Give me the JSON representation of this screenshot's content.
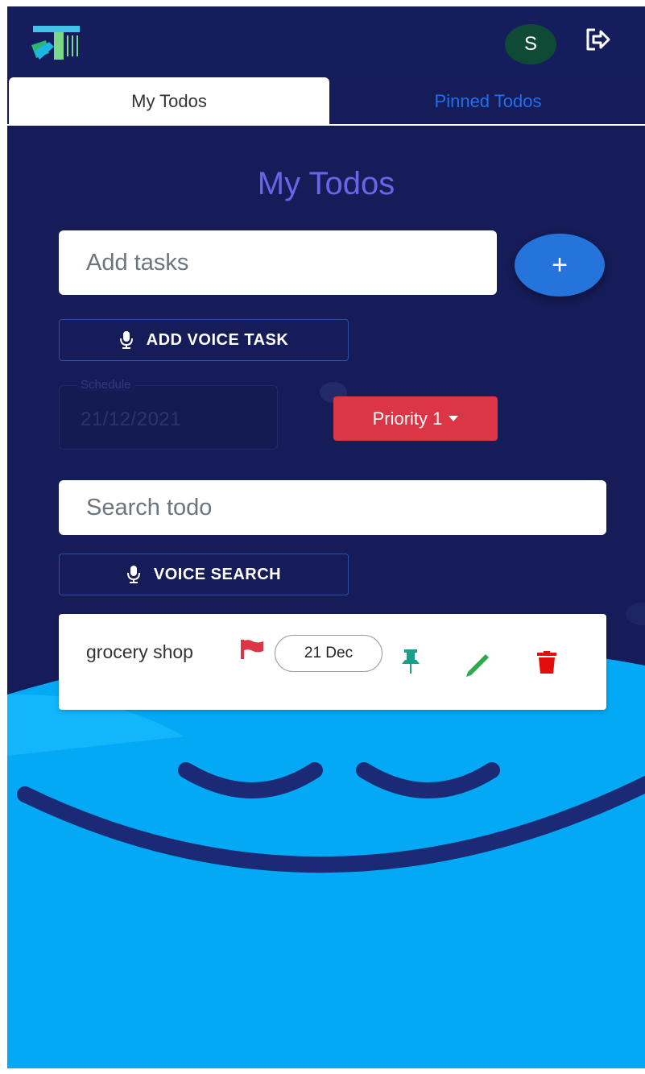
{
  "header": {
    "avatar_initial": "S",
    "icons": {
      "logo": "app-logo",
      "logout": "logout-icon"
    }
  },
  "tabs": [
    {
      "label": "My Todos",
      "active": true
    },
    {
      "label": "Pinned Todos",
      "active": false
    }
  ],
  "page_title": "My Todos",
  "add_task": {
    "placeholder": "Add tasks",
    "add_button_label": "+",
    "voice_button_label": "ADD VOICE TASK"
  },
  "schedule": {
    "label": "Schedule",
    "value": "21/12/2021"
  },
  "priority": {
    "label": "Priority 1",
    "color": "#dc3545"
  },
  "search": {
    "placeholder": "Search todo",
    "voice_button_label": "VOICE SEARCH"
  },
  "todos": [
    {
      "text": "grocery shop",
      "date": "21 Dec",
      "icons": [
        "flag-icon",
        "pin-icon",
        "pencil-icon",
        "trash-icon"
      ],
      "flag_color": "#dc3545"
    }
  ],
  "colors": {
    "background": "#151c58",
    "accent": "#2474dc",
    "title": "#6a64e8",
    "smiley": "#03a9f4"
  }
}
